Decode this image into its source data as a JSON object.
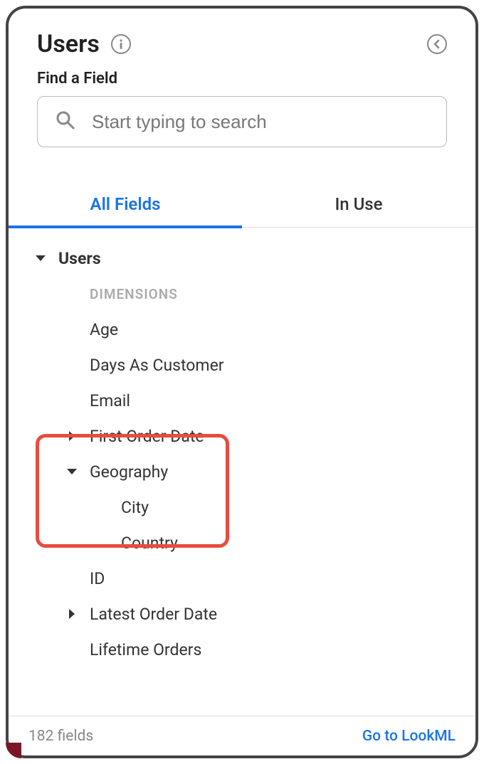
{
  "header": {
    "title": "Users"
  },
  "search": {
    "label": "Find a Field",
    "placeholder": "Start typing to search"
  },
  "tabs": {
    "all_fields": "All Fields",
    "in_use": "In Use"
  },
  "tree": {
    "view_name": "Users",
    "section_dimensions": "Dimensions",
    "fields": {
      "age": "Age",
      "days_as_customer": "Days As Customer",
      "email": "Email",
      "first_order_date": "First Order Date",
      "geography": "Geography",
      "city": "City",
      "country": "Country",
      "id": "ID",
      "latest_order_date": "Latest Order Date",
      "lifetime_orders": "Lifetime Orders"
    }
  },
  "footer": {
    "field_count": "182 fields",
    "go_to_lookml": "Go to LookML"
  }
}
